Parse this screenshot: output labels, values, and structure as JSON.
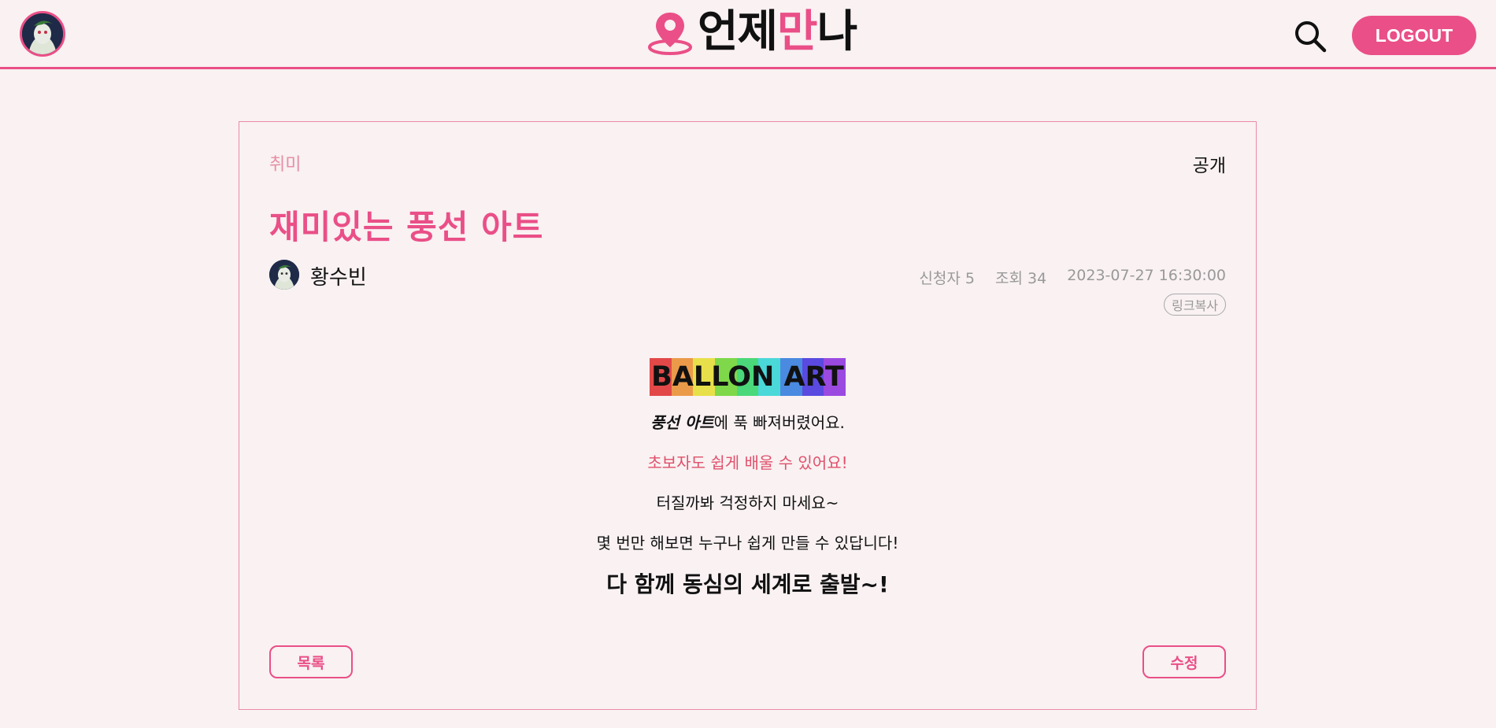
{
  "header": {
    "logo_part1": "언제",
    "logo_part2": "만",
    "logo_part3": "나",
    "logout_label": "LOGOUT",
    "accent_color": "#ea4f87",
    "icons": [
      "profile-avatar",
      "map-pin-icon",
      "search-icon"
    ]
  },
  "post": {
    "category": "취미",
    "visibility": "공개",
    "title": "재미있는 풍선 아트",
    "author": "황수빈",
    "applicants_label": "신청자",
    "applicants_count": "5",
    "views_label": "조회",
    "views_count": "34",
    "datetime": "2023-07-27 16:30:00",
    "copy_link_label": "링크복사"
  },
  "content": {
    "banner": "BALLON ART",
    "line1_bold": "풍선 아트",
    "line1_rest": "에 푹 빠져버렸어요.",
    "line2": "초보자도 쉽게 배울 수 있어요!",
    "line3": "터질까봐 걱정하지 마세요~",
    "line4": "몇 번만 해보면 누구나 쉽게 만들 수 있답니다!",
    "line5": "다 함께 동심의 세계로 출발~!",
    "banner_colors": [
      "#e34848",
      "#eb9a4a",
      "#e8e04a",
      "#7ed84a",
      "#4ad87a",
      "#4ad8d8",
      "#4a8ae0",
      "#5a4ae0",
      "#9a4ae0"
    ]
  },
  "actions": {
    "list_label": "목록",
    "edit_label": "수정"
  }
}
